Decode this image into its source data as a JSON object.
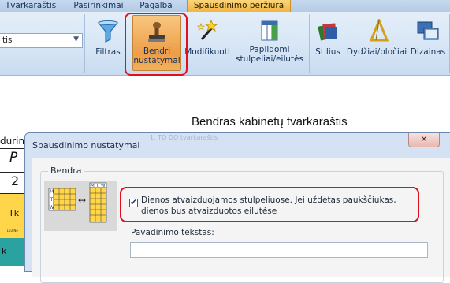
{
  "menu_tabs": [
    "Tvarkaraštis",
    "Pasirinkimai",
    "Pagalba",
    "Spausdinimo peržiūra"
  ],
  "ribbon": {
    "combo_value": "tis",
    "buttons": {
      "filter": "Filtras",
      "general_line1": "Bendri",
      "general_line2": "nustatymai",
      "modify": "Modifikuoti",
      "extra_line1": "Papildomi",
      "extra_line2": "stulpeliai/eilutės",
      "styles": "Stilius",
      "sizes": "Dydžiai/pločiai",
      "designs": "Dizainas"
    }
  },
  "document": {
    "title": "Bendras kabinetų tvarkaraštis",
    "frag_top": "durin",
    "frag_p": "P",
    "frag_num": "2",
    "frag_tk": "Tk",
    "frag_small": "T103 Ne",
    "frag_k": "k"
  },
  "dialog": {
    "title": "Spausdinimo nustatymai",
    "ghost_text": "1. TO DO tvarkaraštis",
    "close_symbol": "✕",
    "group_label": "Bendra",
    "preview_days": [
      "M",
      "T",
      "W"
    ],
    "checkbox_checked": true,
    "checkbox_label": "Dienos atvaizduojamos stulpeliuose. Jei uždėtas paukščiukas, dienos bus atvaizduotos eilutėse",
    "field_label": "Pavadinimo tekstas:",
    "field_value": ""
  },
  "colors": {
    "highlight": "#e0101c",
    "active_tab": "#f3b540",
    "pressed_button": "#ee9d47",
    "grid_yellow": "#ffd54a"
  }
}
